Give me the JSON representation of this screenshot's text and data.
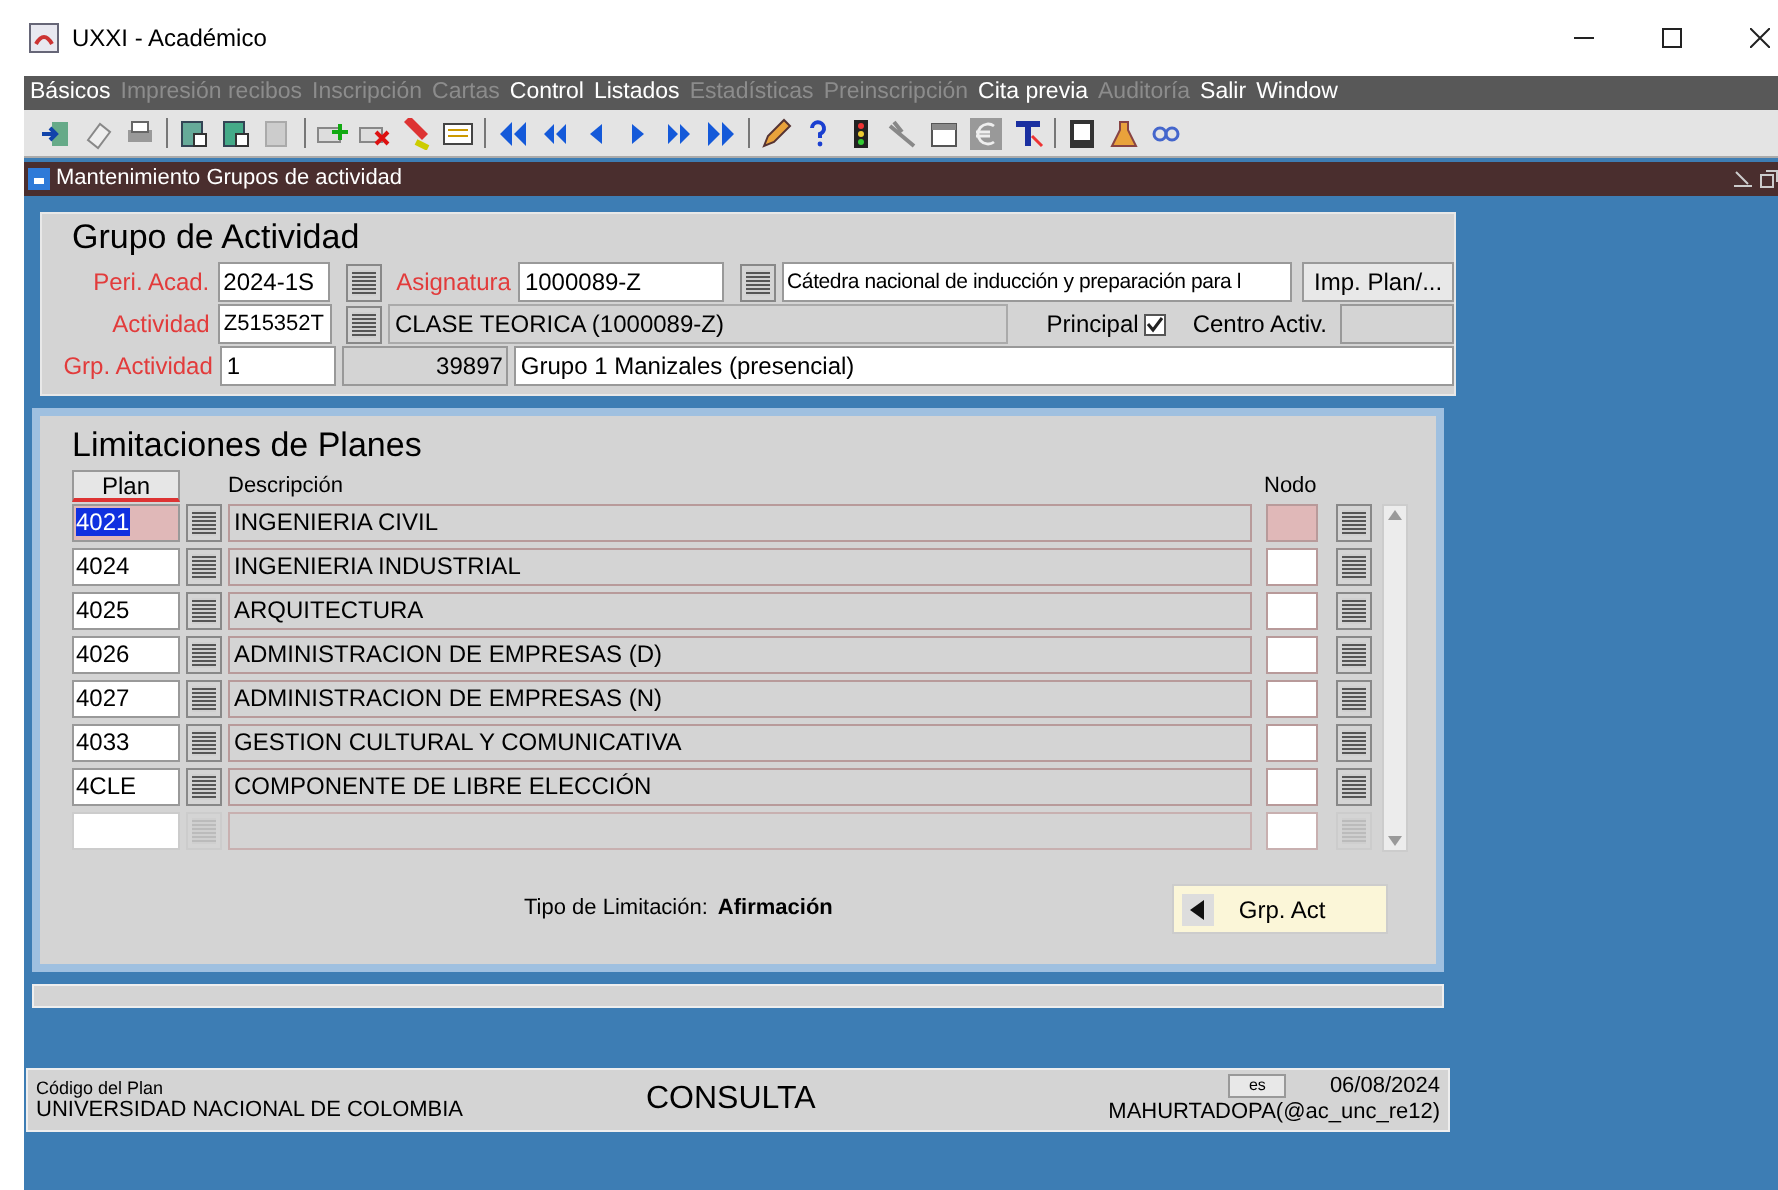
{
  "window": {
    "title": "UXXI - Académico"
  },
  "menu": [
    {
      "label": "Básicos",
      "disabled": false
    },
    {
      "label": "Impresión recibos",
      "disabled": true
    },
    {
      "label": "Inscripción",
      "disabled": true
    },
    {
      "label": "Cartas",
      "disabled": true
    },
    {
      "label": "Control",
      "disabled": false
    },
    {
      "label": "Listados",
      "disabled": false
    },
    {
      "label": "Estadísticas",
      "disabled": true
    },
    {
      "label": "Preinscripción",
      "disabled": true
    },
    {
      "label": "Cita previa",
      "disabled": false
    },
    {
      "label": "Auditoría",
      "disabled": true
    },
    {
      "label": "Salir",
      "disabled": false
    },
    {
      "label": "Window",
      "disabled": false
    }
  ],
  "form": {
    "title": "Mantenimiento Grupos de actividad"
  },
  "grupo": {
    "title": "Grupo de Actividad",
    "peri_acad": {
      "label": "Peri. Acad.",
      "value": "2024-1S"
    },
    "asignatura": {
      "label": "Asignatura",
      "value": "1000089-Z",
      "description": "Cátedra nacional de inducción y preparación para l"
    },
    "imp_button": "Imp. Plan/...",
    "actividad": {
      "label": "Actividad",
      "value": "Z515352T",
      "description": "CLASE TEORICA (1000089-Z)"
    },
    "principal": {
      "label": "Principal",
      "checked": true
    },
    "centro": {
      "label": "Centro Activ."
    },
    "grp_actividad": {
      "label": "Grp. Actividad",
      "value": "1",
      "number": "39897",
      "description": "Grupo 1 Manizales (presencial)"
    }
  },
  "limitaciones": {
    "title": "Limitaciones de Planes",
    "columns": [
      "Plan",
      "Descripción",
      "Nodo"
    ],
    "rows": [
      {
        "plan": "4021",
        "description": "INGENIERIA CIVIL",
        "selected": true
      },
      {
        "plan": "4024",
        "description": "INGENIERIA INDUSTRIAL",
        "selected": false
      },
      {
        "plan": "4025",
        "description": "ARQUITECTURA",
        "selected": false
      },
      {
        "plan": "4026",
        "description": "ADMINISTRACION DE EMPRESAS (D)",
        "selected": false
      },
      {
        "plan": "4027",
        "description": "ADMINISTRACION DE EMPRESAS (N)",
        "selected": false
      },
      {
        "plan": "4033",
        "description": "GESTION CULTURAL Y COMUNICATIVA",
        "selected": false
      },
      {
        "plan": "4CLE",
        "description": "COMPONENTE DE LIBRE ELECCIÓN",
        "selected": false
      }
    ],
    "tipo_label": "Tipo de Limitación:",
    "tipo_value": "Afirmación",
    "button": "Grp. Act"
  },
  "status_bar": {
    "field_label": "Código del Plan",
    "institution": "UNIVERSIDAD NACIONAL DE COLOMBIA",
    "mode": "CONSULTA",
    "language": "es",
    "date": "06/08/2024",
    "user": "MAHURTADOPA(@ac_unc_re12)"
  }
}
